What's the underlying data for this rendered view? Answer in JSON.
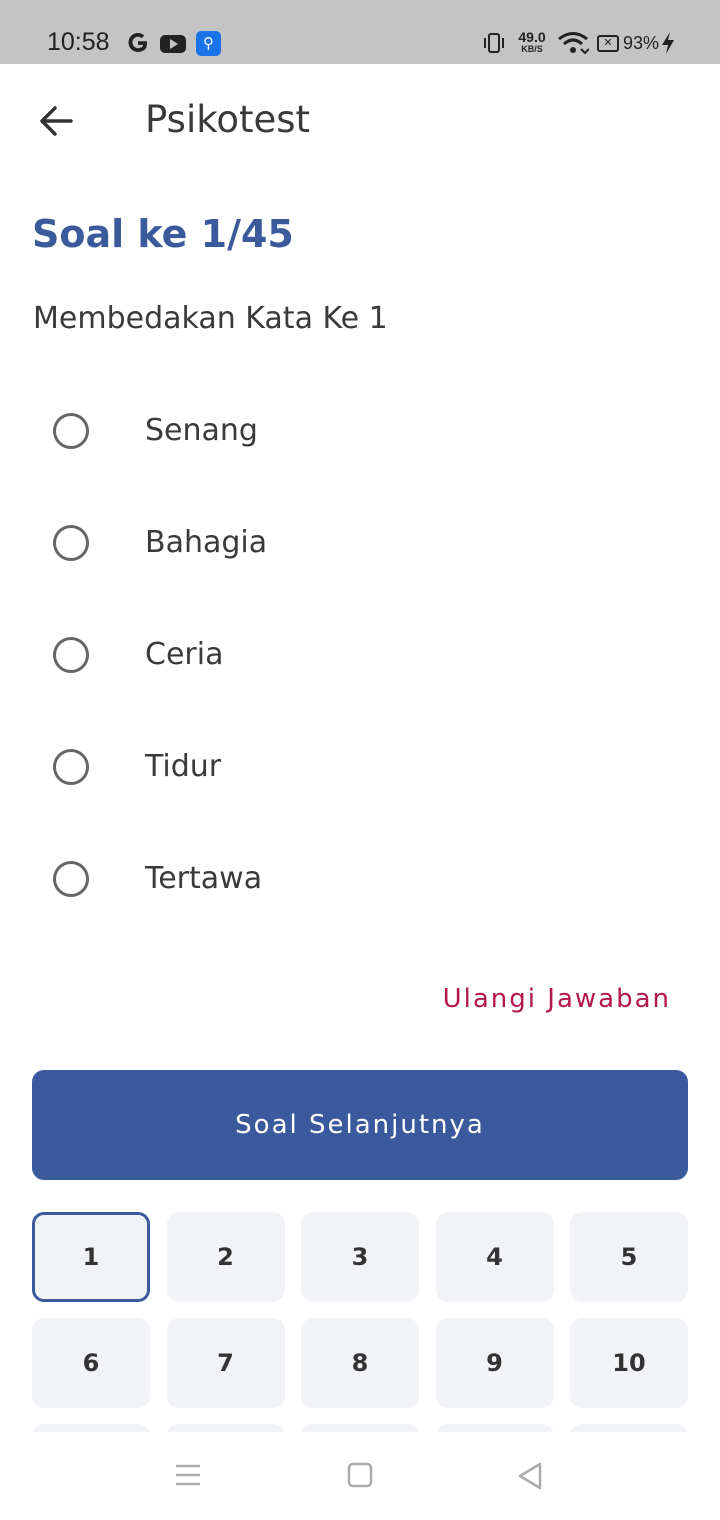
{
  "status_bar": {
    "time": "10:58",
    "net_speed_value": "49.0",
    "net_speed_unit": "KB/S",
    "battery_percent": "93%",
    "icons": [
      "google-icon",
      "youtube-icon",
      "usb-icon",
      "vibrate-icon",
      "wifi-icon",
      "battery-saver-icon",
      "charging-icon"
    ]
  },
  "app_bar": {
    "title": "Psikotest",
    "back_icon": "arrow-left-icon"
  },
  "question": {
    "number_label": "Soal ke 1/45",
    "text": "Membedakan Kata Ke 1"
  },
  "options": [
    {
      "label": "Senang",
      "selected": false
    },
    {
      "label": "Bahagia",
      "selected": false
    },
    {
      "label": "Ceria",
      "selected": false
    },
    {
      "label": "Tidur",
      "selected": false
    },
    {
      "label": "Tertawa",
      "selected": false
    }
  ],
  "reset_label": "Ulangi Jawaban",
  "next_button_label": "Soal Selanjutnya",
  "question_nav": {
    "current": 1,
    "numbers": [
      "1",
      "2",
      "3",
      "4",
      "5",
      "6",
      "7",
      "8",
      "9",
      "10"
    ]
  },
  "colors": {
    "accent": "#3b5a9d",
    "reset": "#b3174f",
    "tile_bg": "#f1f3f6",
    "status_bar": "#c4c4c4"
  }
}
